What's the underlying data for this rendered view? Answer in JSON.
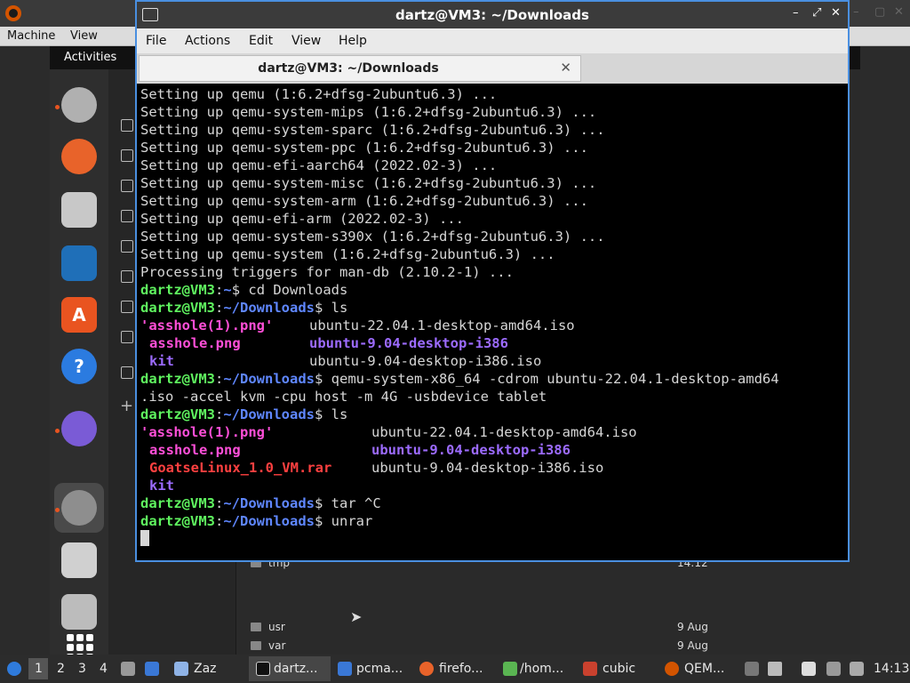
{
  "host": {
    "controls": [
      "–",
      "▢",
      "✕"
    ]
  },
  "qemu_menu": {
    "machine": "Machine",
    "view": "View"
  },
  "guest": {
    "activities": "Activities"
  },
  "file_manager": {
    "rows": [
      {
        "name": "tmp",
        "date": "14:12"
      },
      {
        "name": "usr",
        "date": "9 Aug"
      },
      {
        "name": "var",
        "date": "9 Aug"
      }
    ]
  },
  "terminal": {
    "title": "dartz@VM3: ~/Downloads",
    "tab_title": "dartz@VM3: ~/Downloads",
    "tab_close": "✕",
    "controls": [
      "–",
      "⤢",
      "✕"
    ],
    "menu": {
      "file": "File",
      "actions": "Actions",
      "edit": "Edit",
      "view": "View",
      "help": "Help"
    },
    "output": [
      "Setting up qemu (1:6.2+dfsg-2ubuntu6.3) ...",
      "Setting up qemu-system-mips (1:6.2+dfsg-2ubuntu6.3) ...",
      "Setting up qemu-system-sparc (1:6.2+dfsg-2ubuntu6.3) ...",
      "Setting up qemu-system-ppc (1:6.2+dfsg-2ubuntu6.3) ...",
      "Setting up qemu-efi-aarch64 (2022.02-3) ...",
      "Setting up qemu-system-misc (1:6.2+dfsg-2ubuntu6.3) ...",
      "Setting up qemu-system-arm (1:6.2+dfsg-2ubuntu6.3) ...",
      "Setting up qemu-efi-arm (2022.02-3) ...",
      "Setting up qemu-system-s390x (1:6.2+dfsg-2ubuntu6.3) ...",
      "Setting up qemu-system (1:6.2+dfsg-2ubuntu6.3) ...",
      "Processing triggers for man-db (2.10.2-1) ..."
    ],
    "prompt_user": "dartz@VM3",
    "prompt_colon": ":",
    "prompt_home": "~",
    "prompt_downloads": "~/Downloads",
    "prompt_dollar": "$ ",
    "cmd_cd": "cd Downloads",
    "cmd_ls": "ls",
    "cmd_qemu_1": "qemu-system-x86_64 -cdrom ubuntu-22.04.1-desktop-amd64",
    "cmd_qemu_2": ".iso -accel kvm -cpu host -m 4G -usbdevice tablet",
    "cmd_tar": "tar ^C",
    "cmd_unrar": "unrar",
    "ls1": {
      "f1": "'asshole(1).png'",
      "f2": "asshole.png",
      "f3": "kit",
      "f4": "ubuntu-22.04.1-desktop-amd64.iso",
      "f5": "ubuntu-9.04-desktop-i386",
      "f6": "ubuntu-9.04-desktop-i386.iso"
    },
    "ls2": {
      "f1": "'asshole(1).png'",
      "f2": "asshole.png",
      "f3": "GoatseLinux_1.0_VM.rar",
      "f4": "kit",
      "f5": "ubuntu-22.04.1-desktop-amd64.iso",
      "f6": "ubuntu-9.04-desktop-i386",
      "f7": "ubuntu-9.04-desktop-i386.iso"
    }
  },
  "taskbar": {
    "workspaces": [
      "1",
      "2",
      "3",
      "4"
    ],
    "items": [
      "Zaz",
      "dartz...",
      "pcma...",
      "firefo...",
      "/hom...",
      "cubic",
      "QEM..."
    ],
    "clock": "14:13"
  },
  "colors": {
    "prompt_green": "#5ff35f",
    "path_blue": "#5f87ff",
    "image_magenta": "#ff4fd8",
    "archive_red": "#ff4040",
    "dir_purple": "#9c6bff",
    "focus_border": "#4a8fe0"
  }
}
